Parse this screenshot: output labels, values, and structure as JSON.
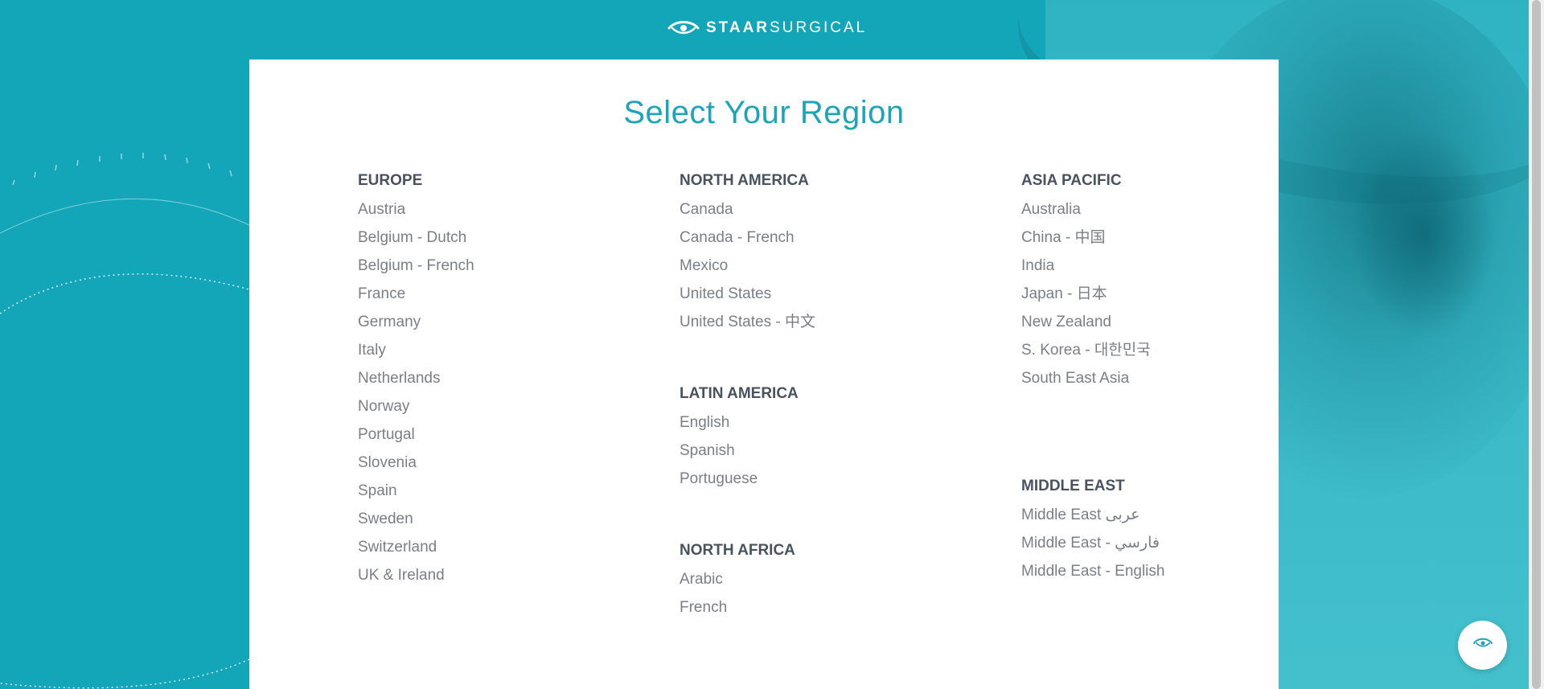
{
  "brand": {
    "logo_bold": "STAAR",
    "logo_light": "SURGICAL",
    "logo_icon": "eye-logo-icon"
  },
  "page_title": "Select Your Region",
  "regions": {
    "europe": {
      "heading": "EUROPE",
      "items": [
        "Austria",
        "Belgium - Dutch",
        "Belgium - French",
        "France",
        "Germany",
        "Italy",
        "Netherlands",
        "Norway",
        "Portugal",
        "Slovenia",
        "Spain",
        "Sweden",
        "Switzerland",
        "UK & Ireland"
      ]
    },
    "north_america": {
      "heading": "NORTH AMERICA",
      "items": [
        "Canada",
        "Canada - French",
        "Mexico",
        "United States",
        "United States - 中文"
      ]
    },
    "latin_america": {
      "heading": "LATIN AMERICA",
      "items": [
        "English",
        "Spanish",
        "Portuguese"
      ]
    },
    "north_africa": {
      "heading": "NORTH AFRICA",
      "items": [
        "Arabic",
        "French"
      ]
    },
    "asia_pacific": {
      "heading": "ASIA PACIFIC",
      "items": [
        "Australia",
        "China - 中国",
        "India",
        "Japan - 日本",
        "New Zealand",
        "S. Korea - 대한민국",
        "South East Asia"
      ]
    },
    "middle_east": {
      "heading": "MIDDLE EAST",
      "items": [
        "Middle East عربى",
        "Middle East - فارسي",
        "Middle East - English"
      ]
    }
  },
  "colors": {
    "background": "#13a6b9",
    "title": "#1fa3b9",
    "heading": "#4a5260",
    "item": "#7a7f87"
  },
  "floating_button_icon": "eye-icon"
}
